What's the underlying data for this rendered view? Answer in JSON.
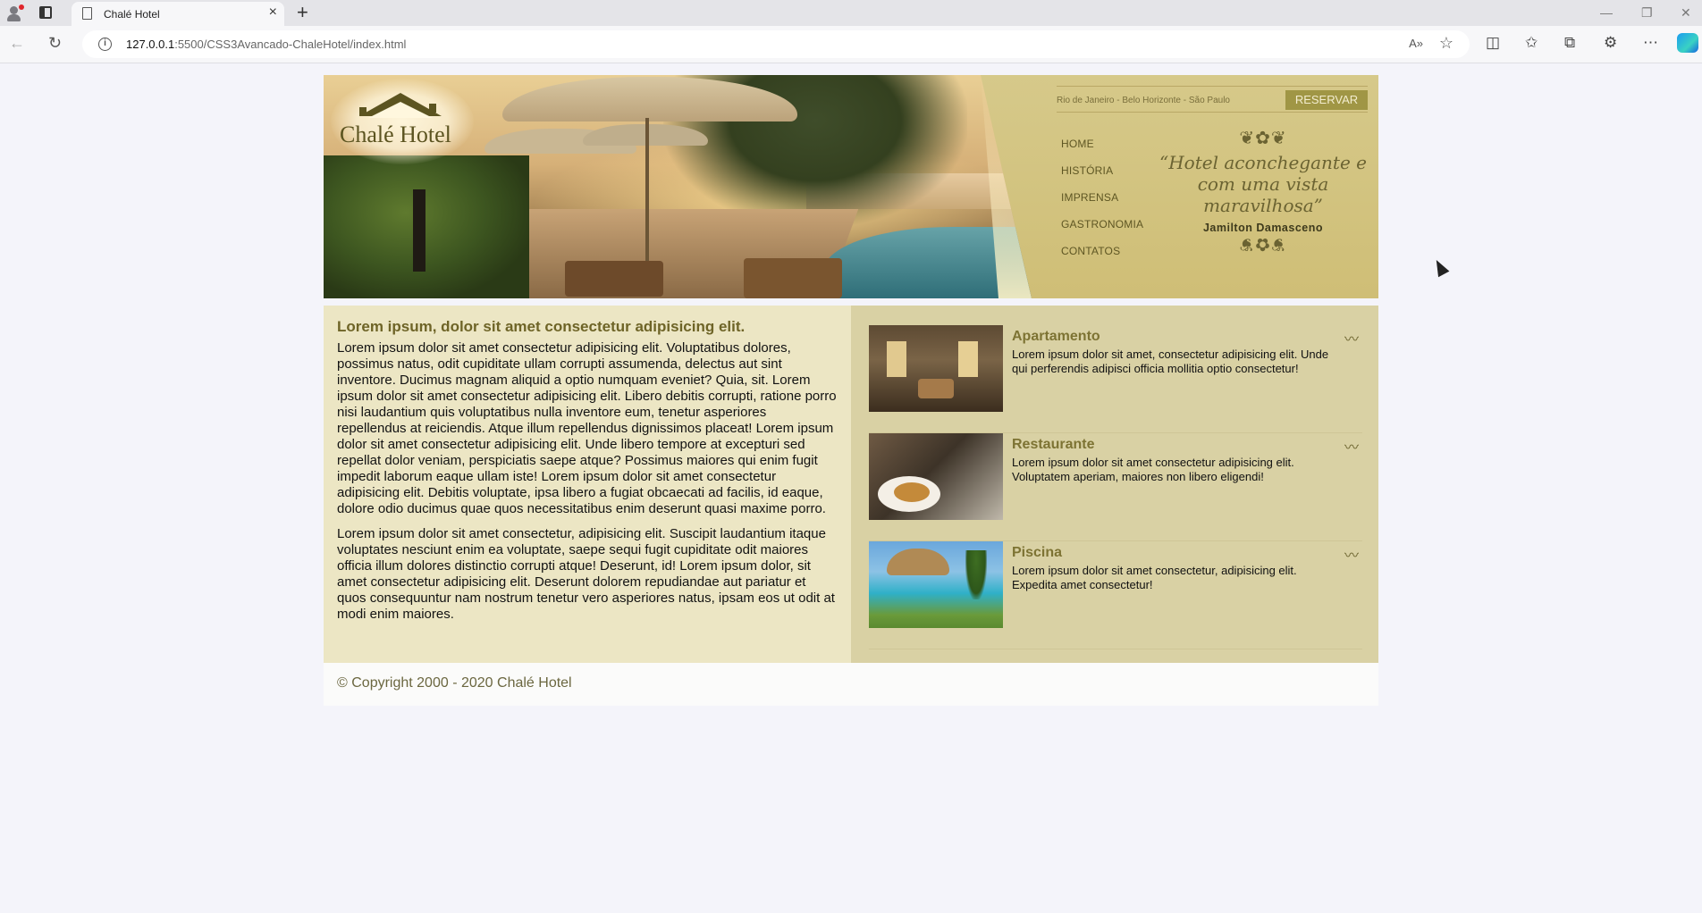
{
  "browser": {
    "tab_title": "Chalé Hotel",
    "url_host": "127.0.0.1",
    "url_rest": ":5500/CSS3Avancado-ChaleHotel/index.html"
  },
  "header": {
    "logo_text": "Chalé Hotel",
    "cities": "Rio de Janeiro - Belo Horizonte - São Paulo",
    "reserve_label": "RESERVAR",
    "menu": [
      "HOME",
      "HISTÓRIA",
      "IMPRENSA",
      "GASTRONOMIA",
      "CONTATOS"
    ],
    "quote_text": "“Hotel aconchegante e com uma vista maravilhosa”",
    "quote_author": "Jamilton Damasceno"
  },
  "main": {
    "heading": "Lorem ipsum, dolor sit amet consectetur adipisicing elit.",
    "paragraphs": [
      "Lorem ipsum dolor sit amet consectetur adipisicing elit. Voluptatibus dolores, possimus natus, odit cupiditate ullam corrupti assumenda, delectus aut sint inventore. Ducimus magnam aliquid a optio numquam eveniet? Quia, sit. Lorem ipsum dolor sit amet consectetur adipisicing elit. Libero debitis corrupti, ratione porro nisi laudantium quis voluptatibus nulla inventore eum, tenetur asperiores repellendus at reiciendis. Atque illum repellendus dignissimos placeat! Lorem ipsum dolor sit amet consectetur adipisicing elit. Unde libero tempore at excepturi sed repellat dolor veniam, perspiciatis saepe atque? Possimus maiores qui enim fugit impedit laborum eaque ullam iste! Lorem ipsum dolor sit amet consectetur adipisicing elit. Debitis voluptate, ipsa libero a fugiat obcaecati ad facilis, id eaque, dolore odio ducimus quae quos necessitatibus enim deserunt quasi maxime porro.",
      "Lorem ipsum dolor sit amet consectetur, adipisicing elit. Suscipit laudantium itaque voluptates nesciunt enim ea voluptate, saepe sequi fugit cupiditate odit maiores officia illum dolores distinctio corrupti atque! Deserunt, id! Lorem ipsum dolor, sit amet consectetur adipisicing elit. Deserunt dolorem repudiandae aut pariatur et quos consequuntur nam nostrum tenetur vero asperiores natus, ipsam eos ut odit at modi enim maiores."
    ]
  },
  "sidebar": {
    "cards": [
      {
        "title": "Apartamento",
        "text": "Lorem ipsum dolor sit amet, consectetur adipisicing elit. Unde qui perferendis adipisci officia mollitia optio consectetur!"
      },
      {
        "title": "Restaurante",
        "text": "Lorem ipsum dolor sit amet consectetur adipisicing elit. Voluptatem aperiam, maiores non libero eligendi!"
      },
      {
        "title": "Piscina",
        "text": "Lorem ipsum dolor sit amet consectetur, adipisicing elit. Expedita amet consectetur!"
      }
    ]
  },
  "footer": {
    "copyright": "© Copyright 2000 - 2020 Chalé Hotel"
  },
  "colors": {
    "accent_olive": "#7d7333",
    "header_gold": "#d6c98a",
    "reserve_button": "#a09645"
  }
}
